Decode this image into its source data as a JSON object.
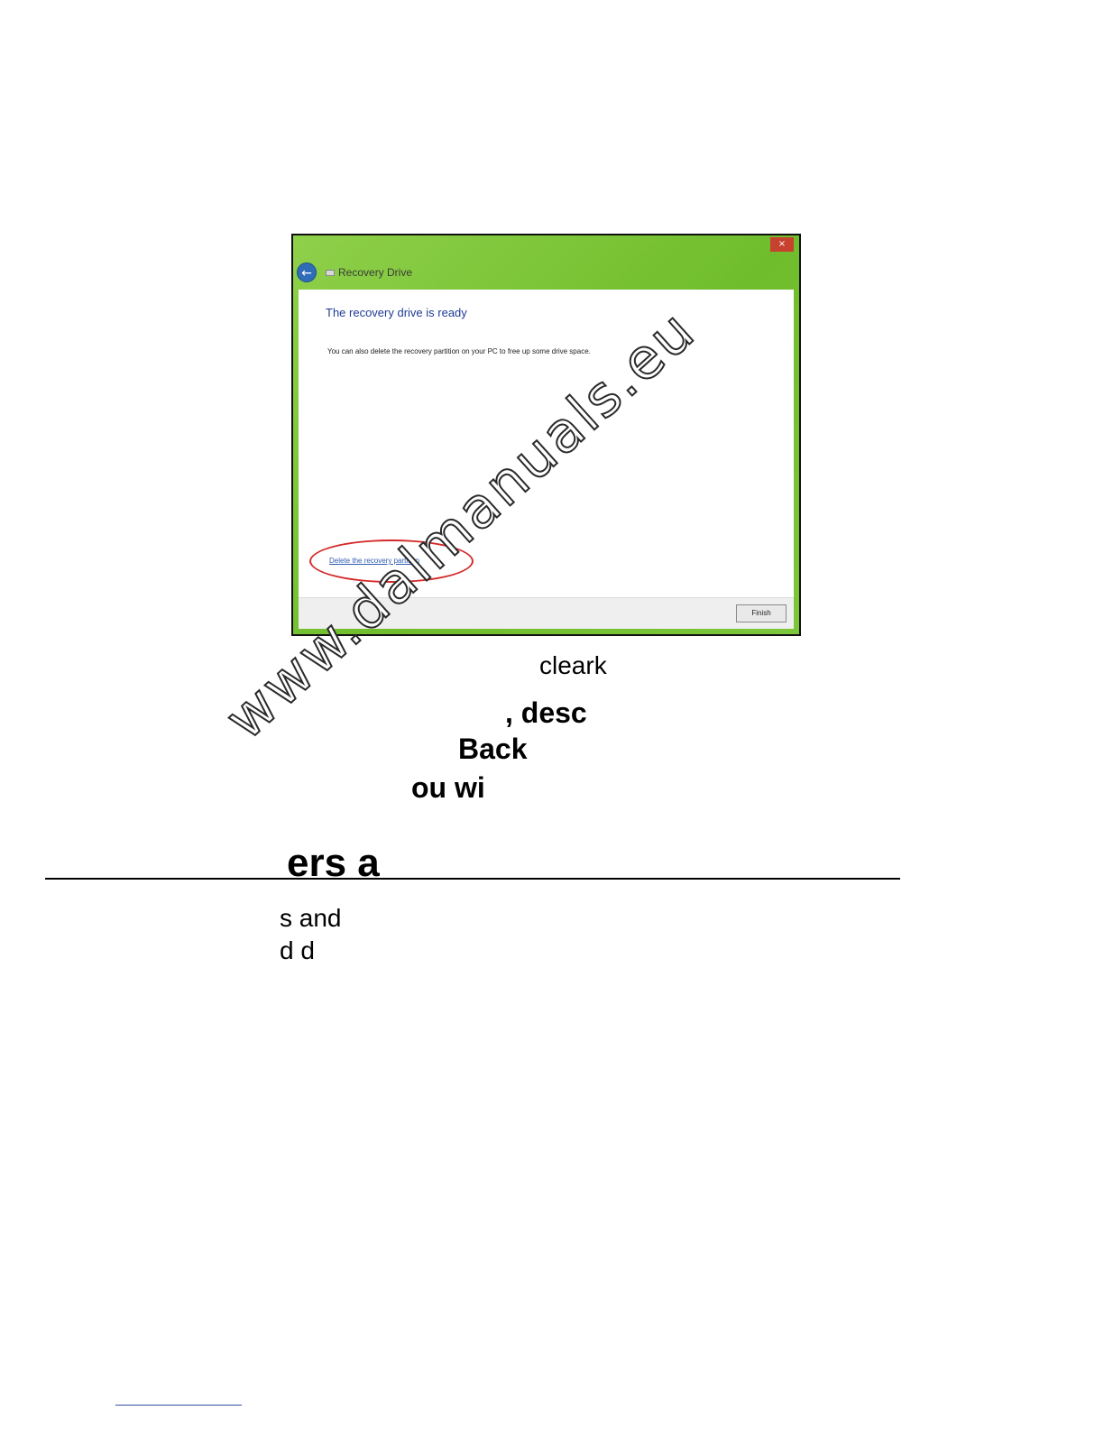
{
  "screenshot": {
    "close_symbol": "×",
    "back_icon": "arrow-left",
    "window_title": "Recovery Drive",
    "heading": "The recovery drive is ready",
    "body_text": "You can also delete the recovery partition on your PC to free up some drive space.",
    "delete_link": "Delete the recovery partition",
    "finish_button": "Finish",
    "accent_color": "#7cc43a",
    "highlight_color": "#d42a2a"
  },
  "fragments": {
    "line1": "cleark",
    "line2": ", desc",
    "line3": "Back",
    "line4": "ou wi",
    "heading": "ers a",
    "line6": "s and",
    "line7": "d d"
  },
  "watermark": "www.dalmanuals.eu"
}
